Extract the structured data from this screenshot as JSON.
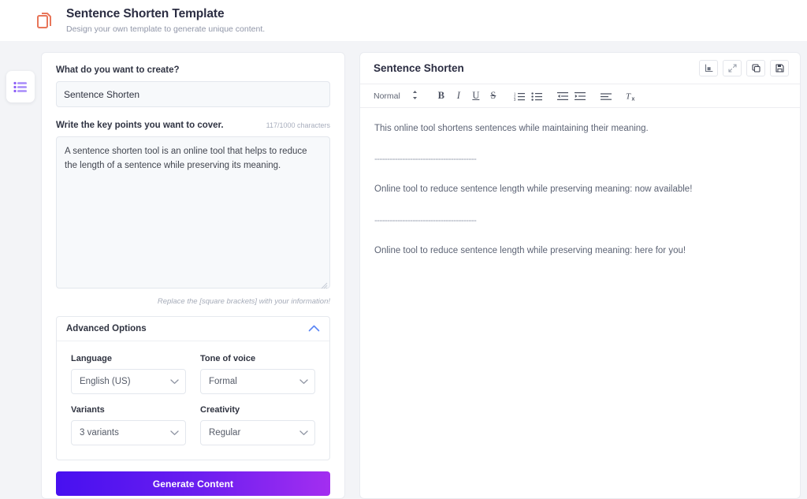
{
  "header": {
    "icon": "duplicate-documents-icon",
    "title": "Sentence Shorten Template",
    "subtitle": "Design your own template to generate unique content.",
    "icon_color": "#e8765a"
  },
  "rail": {
    "icon": "list-menu-icon",
    "icon_color": "#8b5cf6"
  },
  "info": {
    "icon": "info-circle-icon"
  },
  "form": {
    "create_label": "What do you want to create?",
    "create_value": "Sentence Shorten",
    "create_placeholder": "Sentence Shorten",
    "keypoints_label": "Write the key points you want to cover.",
    "char_count": "117/1000 characters",
    "keypoints_value": "A sentence shorten tool is an online tool that helps to reduce the length of a sentence while preserving its meaning.",
    "keypoints_placeholder": "Write the key points you want to cover.",
    "hint": "Replace the [square brackets] with your information!",
    "advanced": {
      "title": "Advanced Options",
      "toggle_icon": "chevron-up-icon",
      "toggle_color": "#5b86f5",
      "options": [
        {
          "label": "Language",
          "value": "English (US)"
        },
        {
          "label": "Tone of voice",
          "value": "Formal"
        },
        {
          "label": "Variants",
          "value": "3 variants"
        },
        {
          "label": "Creativity",
          "value": "Regular"
        }
      ]
    },
    "generate_label": "Generate Content",
    "generate_gradient_from": "#4710f0",
    "generate_gradient_to": "#a32ef0"
  },
  "editor": {
    "title": "Sentence Shorten",
    "actions": [
      {
        "icon": "export-icon",
        "label": "Export"
      },
      {
        "icon": "expand-icon",
        "label": "Expand"
      },
      {
        "icon": "copy-icon",
        "label": "Copy"
      },
      {
        "icon": "save-icon",
        "label": "Save"
      }
    ],
    "toolbar": {
      "style_value": "Normal",
      "style_icon": "updown-arrows-icon",
      "items": [
        {
          "icon": "bold-icon",
          "glyph": "B"
        },
        {
          "icon": "italic-icon",
          "glyph": "I"
        },
        {
          "icon": "underline-icon",
          "glyph": "U"
        },
        {
          "icon": "strikethrough-icon",
          "glyph": "S"
        },
        {
          "icon": "ordered-list-icon",
          "glyph": ""
        },
        {
          "icon": "bullet-list-icon",
          "glyph": ""
        },
        {
          "icon": "outdent-icon",
          "glyph": ""
        },
        {
          "icon": "indent-icon",
          "glyph": ""
        },
        {
          "icon": "align-icon",
          "glyph": ""
        },
        {
          "icon": "clear-format-icon",
          "glyph": ""
        }
      ]
    },
    "content": [
      {
        "type": "paragraph",
        "text": "This online tool shortens sentences while maintaining their meaning."
      },
      {
        "type": "separator",
        "text": "----------------------------------------"
      },
      {
        "type": "paragraph",
        "text": "Online tool to reduce sentence length while preserving meaning: now available!"
      },
      {
        "type": "separator",
        "text": "----------------------------------------"
      },
      {
        "type": "paragraph",
        "text": "Online tool to reduce sentence length while preserving meaning: here for you!"
      }
    ]
  }
}
